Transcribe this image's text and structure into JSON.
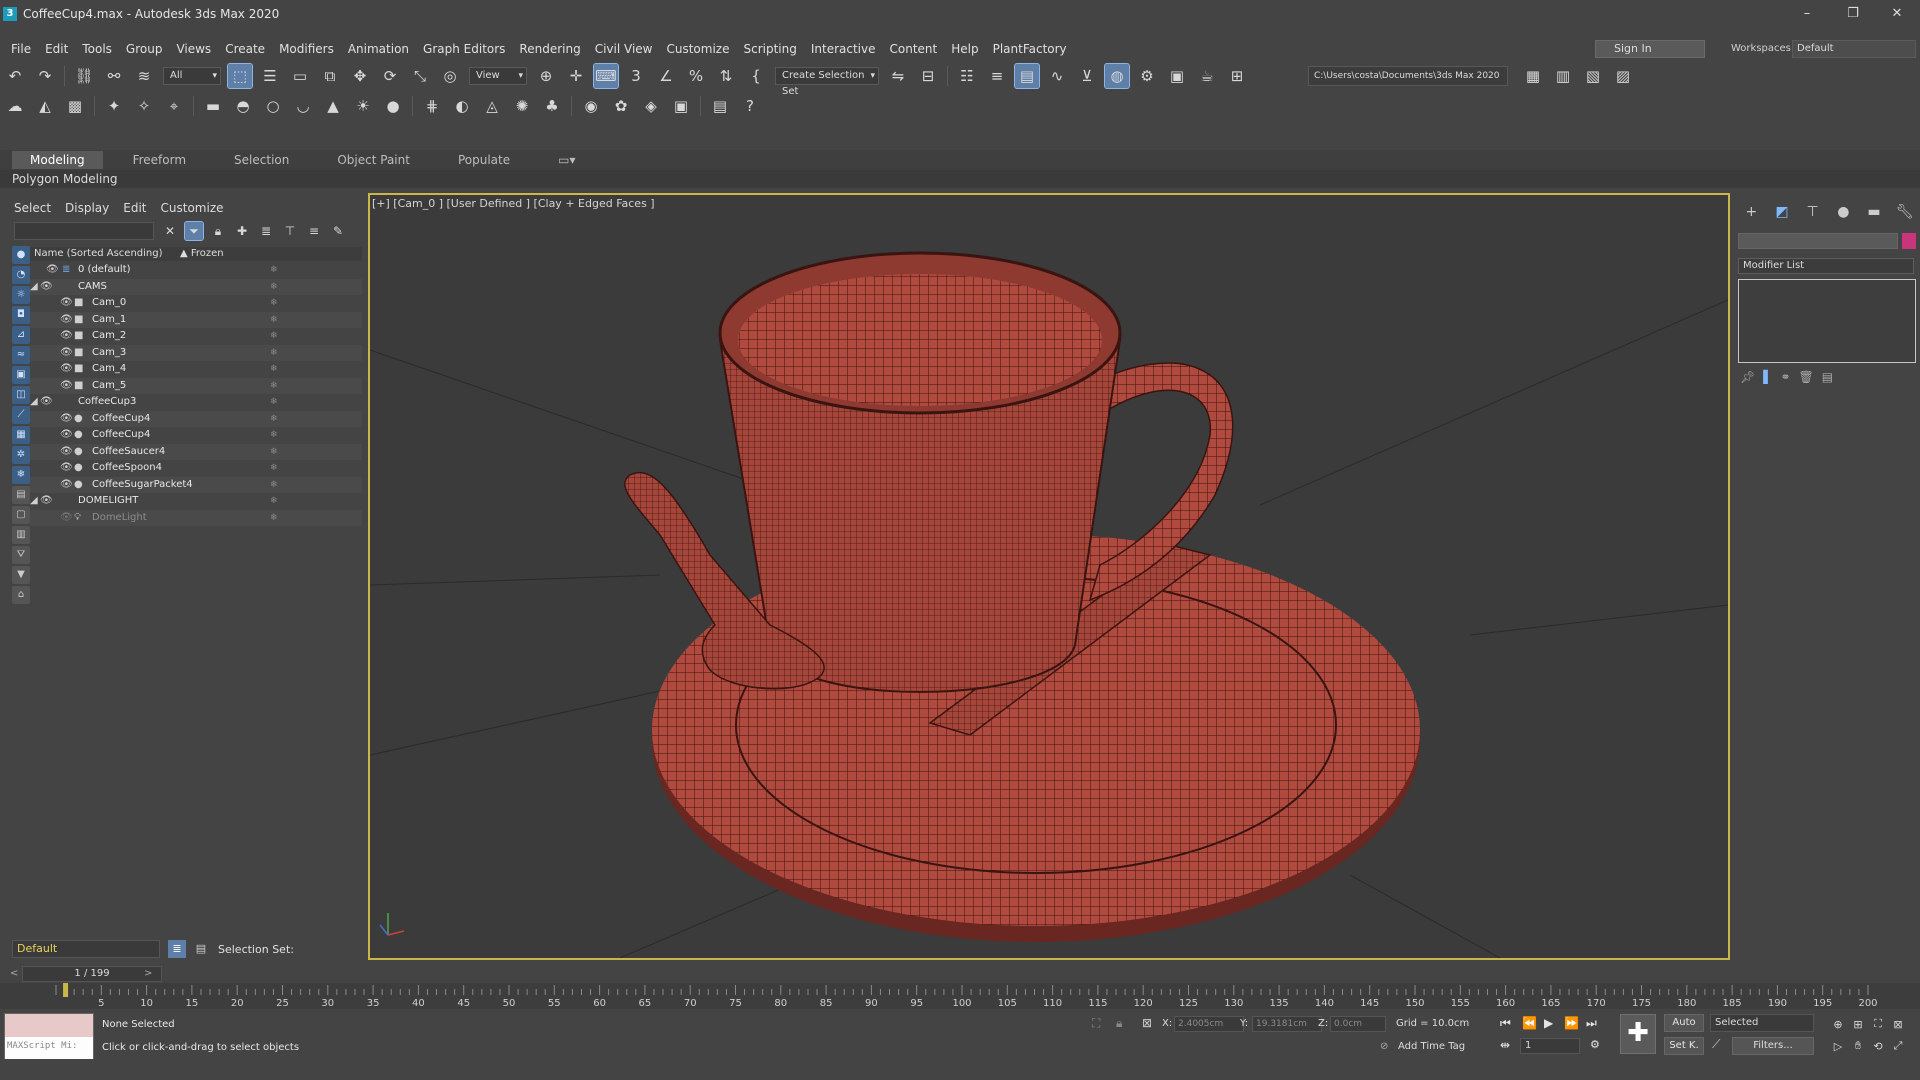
{
  "window": {
    "title": "CoffeeCup4.max - Autodesk 3ds Max 2020",
    "app_icon": "3",
    "controls": [
      "–",
      "❐",
      "✕"
    ]
  },
  "menu": [
    "File",
    "Edit",
    "Tools",
    "Group",
    "Views",
    "Create",
    "Modifiers",
    "Animation",
    "Graph Editors",
    "Rendering",
    "Civil View",
    "Customize",
    "Scripting",
    "Interactive",
    "Content",
    "Help",
    "PlantFactory"
  ],
  "account": {
    "signin_label": "Sign In",
    "workspaces_label": "Workspaces:",
    "workspace_value": "Default"
  },
  "toolbar": {
    "selection_filter": "All",
    "reference_coord": "View",
    "named_selection": "Create Selection Set",
    "project_path": "C:\\Users\\costa\\Documents\\3ds Max 2020"
  },
  "ribbon": {
    "tabs": [
      "Modeling",
      "Freeform",
      "Selection",
      "Object Paint",
      "Populate"
    ],
    "active_tab": "Modeling",
    "sub_label": "Polygon Modeling"
  },
  "explorer": {
    "menu": [
      "Select",
      "Display",
      "Edit",
      "Customize"
    ],
    "col_name": "Name (Sorted Ascending)",
    "col_frozen": "▲ Frozen",
    "rows": [
      {
        "label": "0 (default)",
        "indent": 0,
        "kind": "layer"
      },
      {
        "label": "CAMS",
        "indent": 0,
        "kind": "group"
      },
      {
        "label": "Cam_0",
        "indent": 1,
        "kind": "camera"
      },
      {
        "label": "Cam_1",
        "indent": 1,
        "kind": "camera"
      },
      {
        "label": "Cam_2",
        "indent": 1,
        "kind": "camera"
      },
      {
        "label": "Cam_3",
        "indent": 1,
        "kind": "camera"
      },
      {
        "label": "Cam_4",
        "indent": 1,
        "kind": "camera"
      },
      {
        "label": "Cam_5",
        "indent": 1,
        "kind": "camera"
      },
      {
        "label": "CoffeeCup3",
        "indent": 0,
        "kind": "group"
      },
      {
        "label": "CoffeeCup4",
        "indent": 1,
        "kind": "mesh"
      },
      {
        "label": "CoffeeCup4",
        "indent": 1,
        "kind": "mesh"
      },
      {
        "label": "CoffeeSaucer4",
        "indent": 1,
        "kind": "mesh"
      },
      {
        "label": "CoffeeSpoon4",
        "indent": 1,
        "kind": "mesh"
      },
      {
        "label": "CoffeeSugarPacket4",
        "indent": 1,
        "kind": "mesh"
      },
      {
        "label": "DOMELIGHT",
        "indent": 0,
        "kind": "group"
      },
      {
        "label": "DomeLight",
        "indent": 1,
        "kind": "light"
      }
    ]
  },
  "viewport": {
    "label": "[+] [Cam_0 ] [User Defined ] [Clay + Edged Faces ]"
  },
  "command_panel": {
    "modifier_list": "Modifier List",
    "swatch_color": "#c8357a"
  },
  "layer_bar": {
    "layer": "Default",
    "selection_set_label": "Selection Set:"
  },
  "timeline": {
    "frame_display": "1 / 199",
    "ticks": [
      "0",
      "5",
      "10",
      "15",
      "20",
      "25",
      "30",
      "35",
      "40",
      "45",
      "50",
      "55",
      "60",
      "65",
      "70",
      "75",
      "80",
      "85",
      "90",
      "95",
      "100",
      "105",
      "110",
      "115",
      "120",
      "125",
      "130",
      "135",
      "140",
      "145",
      "150",
      "155",
      "160",
      "165",
      "170",
      "175",
      "180",
      "185",
      "190",
      "195",
      "200"
    ]
  },
  "status": {
    "maxscript": "MAXScript Mi:",
    "selection": "None Selected",
    "prompt": "Click or click-and-drag to select objects",
    "x_label": "X:",
    "x_value": "2.4005cm",
    "y_label": "Y:",
    "y_value": "19.3181cm",
    "z_label": "Z:",
    "z_value": "0.0cm",
    "grid": "Grid = 10.0cm",
    "add_time_tag": "Add Time Tag",
    "frame_value": "1",
    "auto_key": "Auto",
    "set_key": "Set K.",
    "selected": "Selected",
    "filters": "Filters..."
  }
}
